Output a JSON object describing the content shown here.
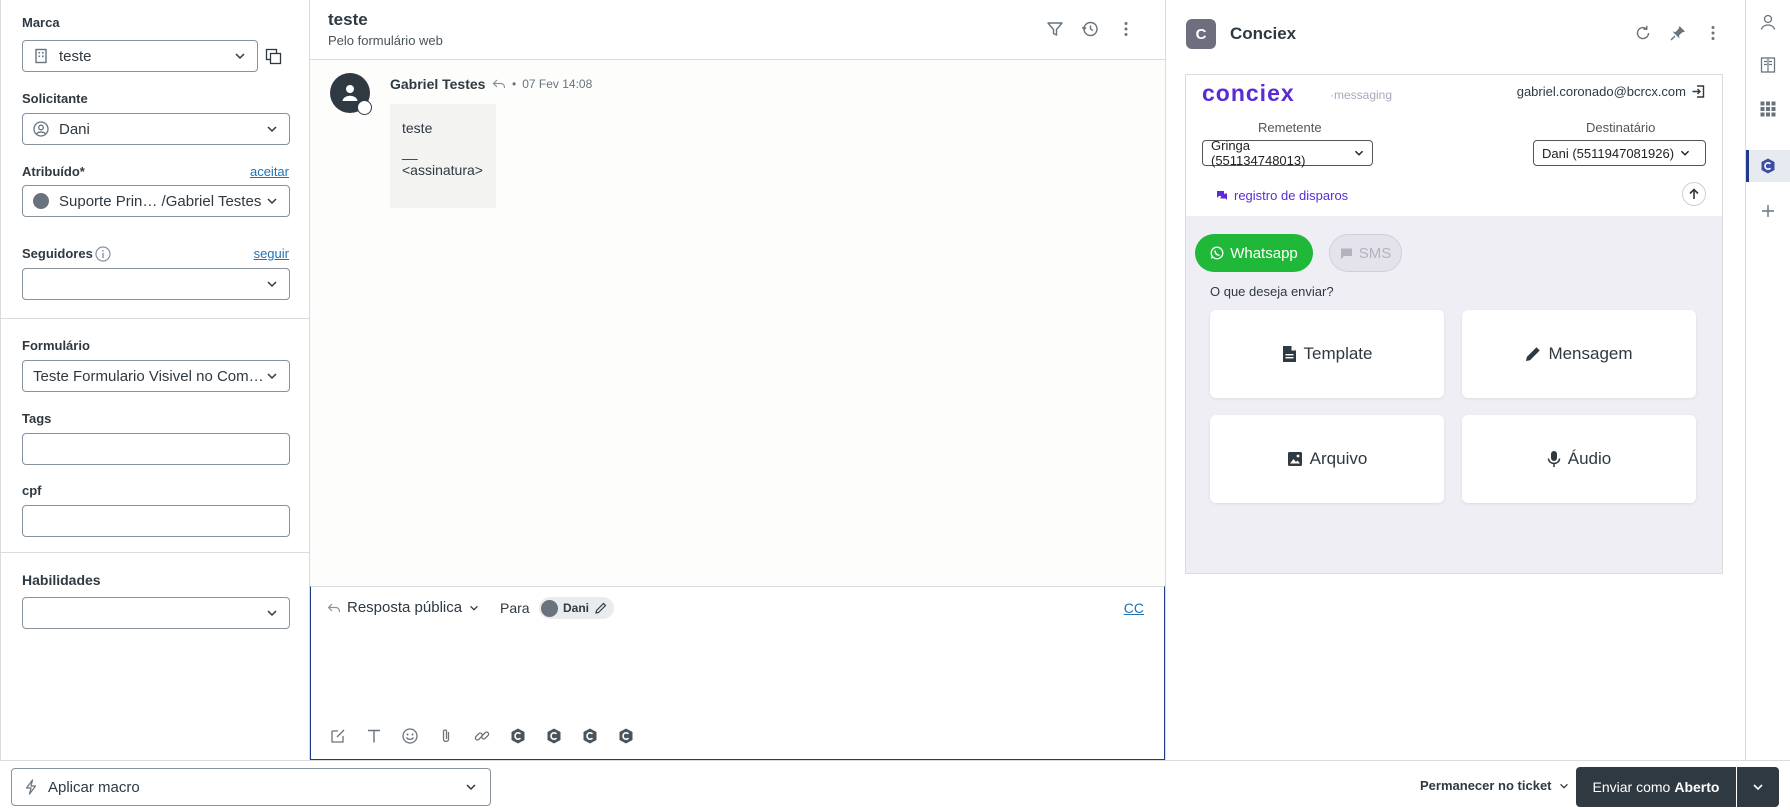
{
  "left": {
    "marca": {
      "label": "Marca",
      "value": "teste"
    },
    "solicitante": {
      "label": "Solicitante",
      "value": "Dani"
    },
    "atribuido": {
      "label": "Atribuído*",
      "link": "aceitar",
      "value": "Suporte Prin… /Gabriel Testes"
    },
    "seguidores": {
      "label": "Seguidores",
      "link": "seguir",
      "value": ""
    },
    "formulario": {
      "label": "Formulário",
      "value": "Teste Formulario Visivel no Com…"
    },
    "tags": {
      "label": "Tags",
      "value": ""
    },
    "cpf": {
      "label": "cpf",
      "value": ""
    },
    "habilidades": {
      "label": "Habilidades",
      "value": ""
    }
  },
  "ticket": {
    "title": "teste",
    "subtitle": "Pelo formulário web",
    "message": {
      "author": "Gabriel Testes",
      "separator": "•",
      "time": "07 Fev 14:08",
      "body_line1": "teste",
      "body_dash": "__",
      "body_line2": "<assinatura>"
    }
  },
  "composer": {
    "reply_type": "Resposta pública",
    "para_label": "Para",
    "recipient": "Dani",
    "cc": "CC"
  },
  "app": {
    "name": "Conciex",
    "logo_letter": "C",
    "brand": "conciex",
    "brand_sub": "·messaging",
    "email": "gabriel.coronado@bcrcx.com",
    "remetente_label": "Remetente",
    "remetente_value": "Gringa (551134748013)",
    "destinatario_label": "Destinatário",
    "destinatario_value": "Dani (5511947081926)",
    "registro": "registro de disparos",
    "channels": {
      "whatsapp": "Whatsapp",
      "sms": "SMS"
    },
    "question": "O que deseja enviar?",
    "cards": {
      "template": "Template",
      "mensagem": "Mensagem",
      "arquivo": "Arquivo",
      "audio": "Áudio"
    }
  },
  "footer": {
    "macro": "Aplicar macro",
    "stay": "Permanecer no ticket",
    "send_prefix": "Enviar como",
    "send_status": "Aberto"
  },
  "colors": {
    "accent": "#1f73b7",
    "brand": "#5b2bd6",
    "whatsapp": "#1fb838",
    "dark": "#2f3941"
  }
}
